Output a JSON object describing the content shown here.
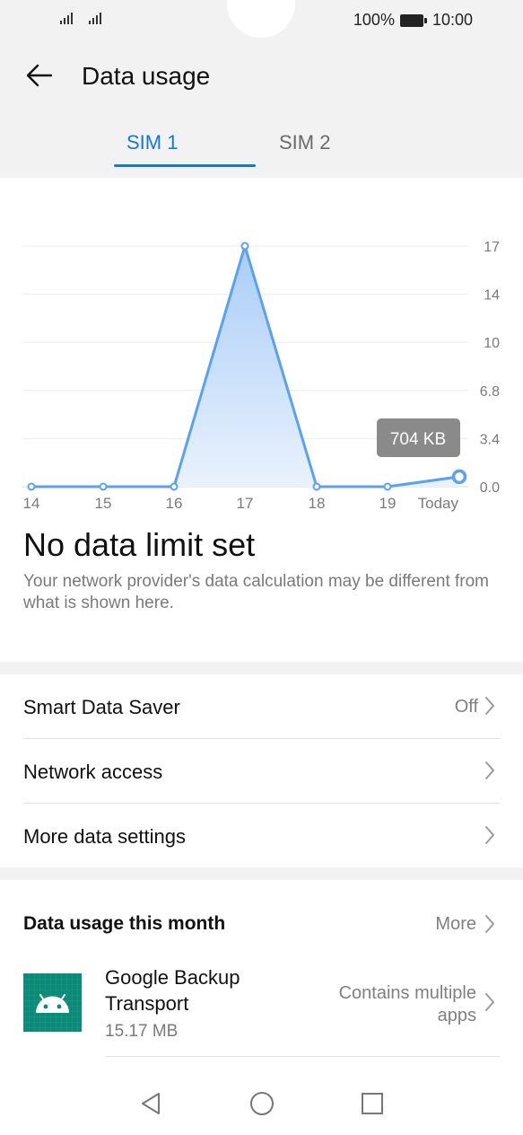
{
  "status": {
    "battery_text": "100%",
    "time": "10:00"
  },
  "header": {
    "title": "Data usage"
  },
  "tabs": [
    {
      "label": "SIM 1",
      "active": true
    },
    {
      "label": "SIM 2",
      "active": false
    }
  ],
  "chart_data": {
    "type": "area",
    "categories": [
      "14",
      "15",
      "16",
      "17",
      "18",
      "19",
      "Today"
    ],
    "values": [
      0,
      0,
      0,
      17,
      0,
      0,
      0.704
    ],
    "y_ticks": [
      "17",
      "14",
      "10",
      "6.8",
      "3.4",
      "0.0"
    ],
    "ylim": [
      0,
      17
    ],
    "grid": true,
    "tooltip": "704 KB",
    "accent": "#5aa2ee",
    "fill": "#cfe3fb"
  },
  "limit": {
    "title": "No data limit set",
    "note": "Your network provider's data calculation may be different from what is shown here."
  },
  "settings": [
    {
      "label": "Smart Data Saver",
      "value": "Off"
    },
    {
      "label": "Network access",
      "value": ""
    },
    {
      "label": "More data settings",
      "value": ""
    }
  ],
  "month": {
    "title": "Data usage this month",
    "more_label": "More",
    "apps": [
      {
        "name": "Google Backup Transport",
        "size": "15.17 MB",
        "info": "Contains multiple apps",
        "icon": "android-icon"
      }
    ]
  },
  "colors": {
    "accent": "#1677d9",
    "background_gray": "#f2f2f2",
    "app_icon_bg": "#0a8a77"
  }
}
